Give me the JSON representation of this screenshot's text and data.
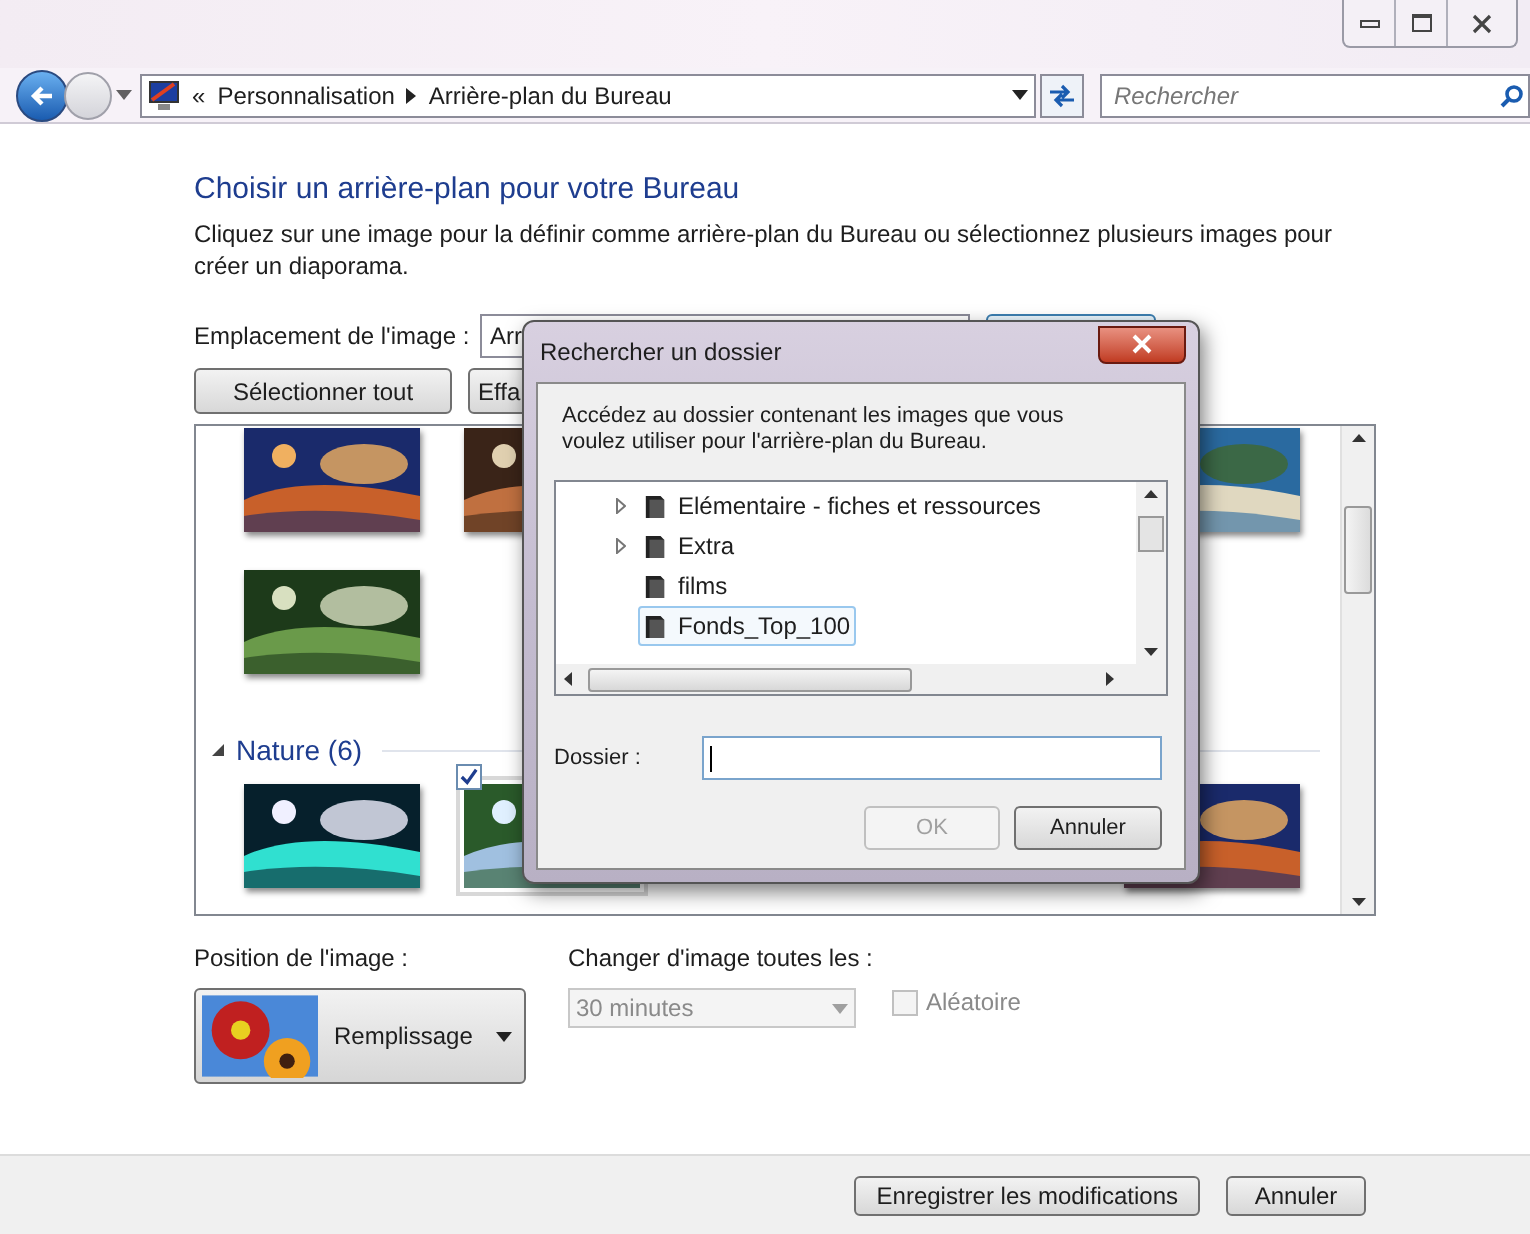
{
  "address_bar": {
    "overflow": "«",
    "breadcrumbs": [
      {
        "label": "Personnalisation"
      },
      {
        "label": "Arrière-plan du Bureau"
      }
    ]
  },
  "search": {
    "placeholder": "Rechercher"
  },
  "heading": "Choisir un arrière-plan pour votre Bureau",
  "description": "Cliquez sur une image pour la définir comme arrière-plan du Bureau ou sélectionnez plusieurs images pour créer un diaporama.",
  "location": {
    "label": "Emplacement de l'image :",
    "value": "Arr"
  },
  "top_buttons": [
    "Sélectionner tout",
    "Effa"
  ],
  "gallery": {
    "sections": [
      {
        "rows": [
          [
            {
              "checked": false
            },
            {
              "checked": false
            },
            {
              "checked": false
            }
          ],
          [
            {
              "checked": false
            }
          ]
        ]
      },
      {
        "title": "Nature (6)",
        "rows": [
          [
            {
              "checked": false
            },
            {
              "checked": true
            },
            {
              "checked": false
            }
          ]
        ]
      }
    ]
  },
  "position": {
    "label": "Position de l'image :",
    "value": "Remplissage"
  },
  "interval": {
    "label": "Changer d'image toutes les :",
    "value": "30 minutes",
    "disabled": true
  },
  "shuffle": {
    "label": "Aléatoire",
    "checked": false,
    "disabled": true
  },
  "footer_buttons": [
    "Enregistrer les modifications",
    "Annuler"
  ],
  "dialog": {
    "title": "Rechercher un dossier",
    "description": "Accédez au dossier contenant les images que vous voulez utiliser pour l'arrière-plan du Bureau.",
    "tree": [
      {
        "label": "Elémentaire - fiches et ressources",
        "has_children": true,
        "selected": false
      },
      {
        "label": "Extra",
        "has_children": true,
        "selected": false
      },
      {
        "label": "films",
        "has_children": false,
        "selected": false
      },
      {
        "label": "Fonds_Top_100",
        "has_children": false,
        "selected": true
      }
    ],
    "folder_label": "Dossier :",
    "buttons": [
      {
        "label": "OK",
        "disabled": true
      },
      {
        "label": "Annuler",
        "disabled": false
      }
    ]
  }
}
